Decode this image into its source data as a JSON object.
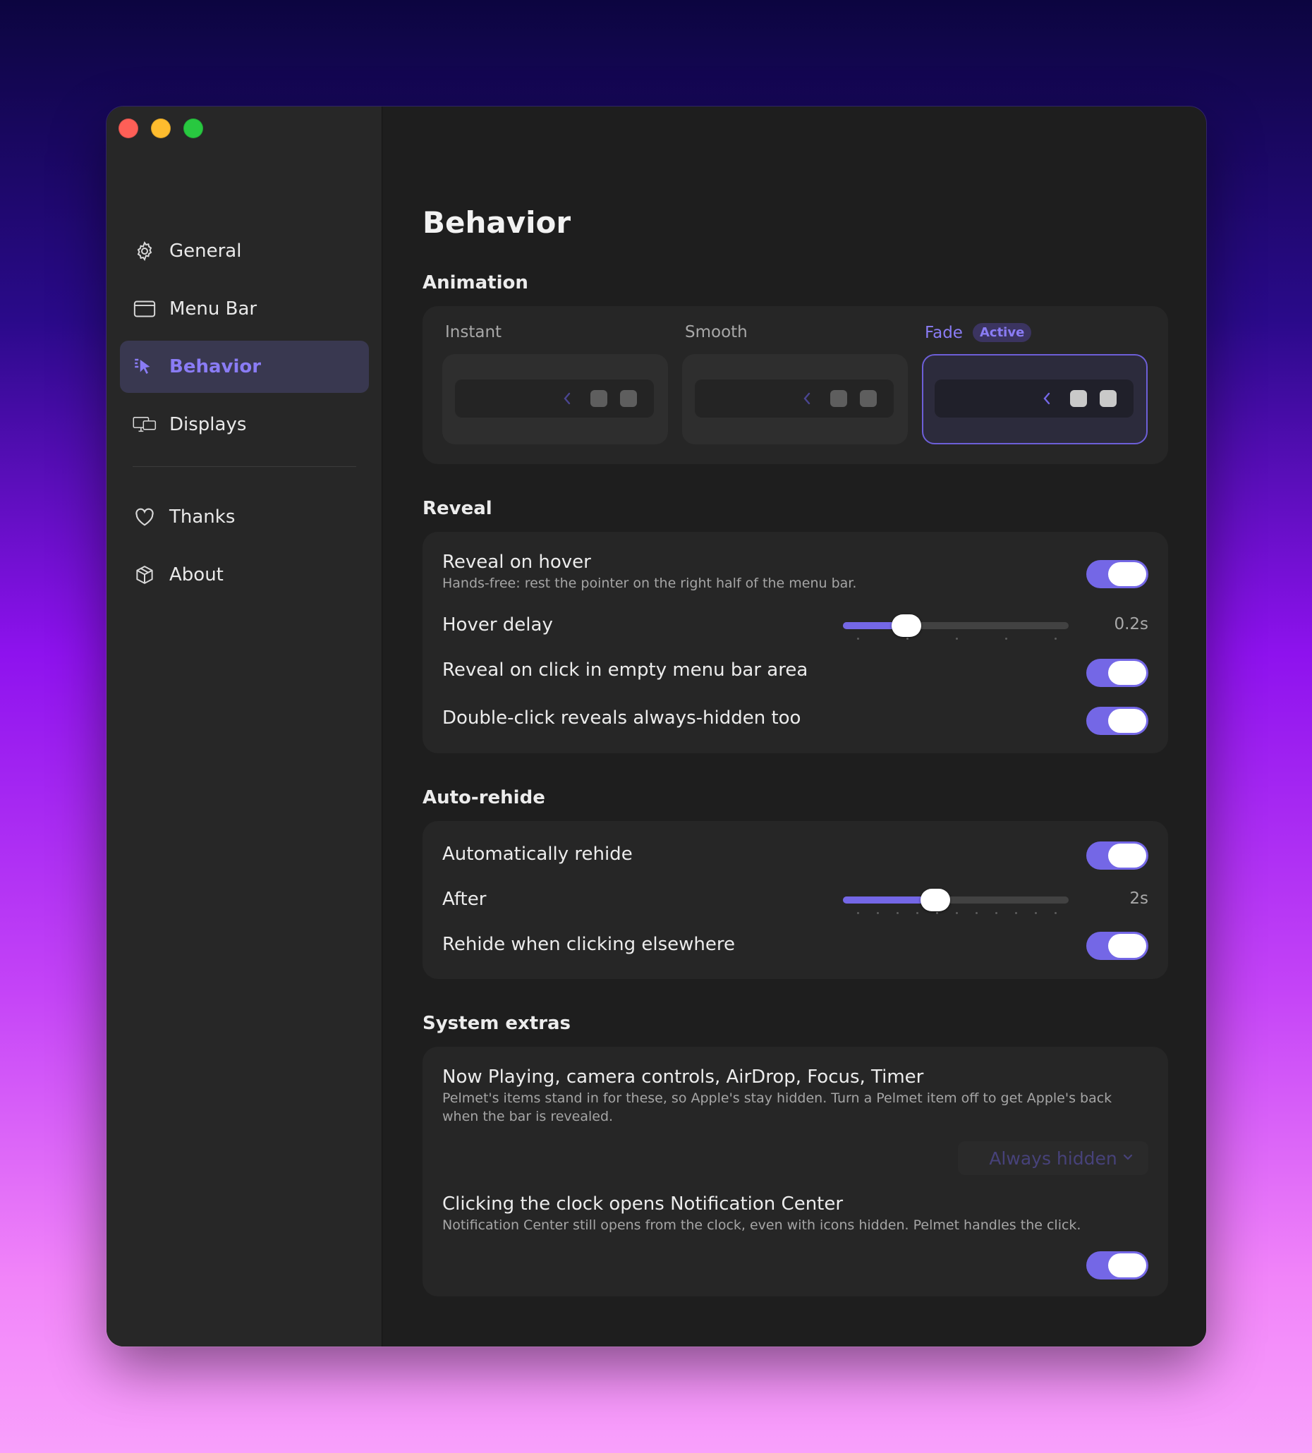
{
  "sidebar": {
    "items": [
      {
        "label": "General",
        "icon": "gear-icon"
      },
      {
        "label": "Menu Bar",
        "icon": "menubar-window-icon"
      },
      {
        "label": "Behavior",
        "icon": "cursor-icon",
        "active": true
      },
      {
        "label": "Displays",
        "icon": "displays-icon"
      },
      {
        "label": "Thanks",
        "icon": "heart-icon"
      },
      {
        "label": "About",
        "icon": "box-icon"
      }
    ]
  },
  "main": {
    "title": "Behavior",
    "animation": {
      "title": "Animation",
      "options": [
        {
          "label": "Instant"
        },
        {
          "label": "Smooth"
        },
        {
          "label": "Fade",
          "badge": "Active",
          "selected": true
        }
      ]
    },
    "reveal": {
      "title": "Reveal",
      "hover": {
        "label": "Reveal on hover",
        "sub": "Hands-free: rest the pointer on the right half of the menu bar.",
        "on": true
      },
      "hover_delay": {
        "label": "Hover delay",
        "value": "0.2s",
        "fraction": 0.28
      },
      "click": {
        "label": "Reveal on click in empty menu bar area",
        "on": true
      },
      "double_click": {
        "label": "Double-click reveals always-hidden too",
        "on": true
      }
    },
    "autorehide": {
      "title": "Auto-rehide",
      "auto": {
        "label": "Automatically rehide",
        "on": true
      },
      "after": {
        "label": "After",
        "value": "2s",
        "fraction": 0.41
      },
      "elsewhere": {
        "label": "Rehide when clicking elsewhere",
        "on": true
      }
    },
    "extras": {
      "title": "System extras",
      "now_playing": {
        "label": "Now Playing, camera controls, AirDrop, Focus, Timer",
        "sub": "Pelmet's items stand in for these, so Apple's stay hidden. Turn a Pelmet item off to get Apple's back when the bar is revealed.",
        "dropdown": "Always hidden"
      },
      "clock": {
        "label": "Clicking the clock opens Notification Center",
        "sub": "Notification Center still opens from the clock, even with icons hidden. Pelmet handles the click.",
        "on": true
      }
    }
  },
  "colors": {
    "accent": "#7467e6",
    "accent_text": "#8a7cf5"
  }
}
